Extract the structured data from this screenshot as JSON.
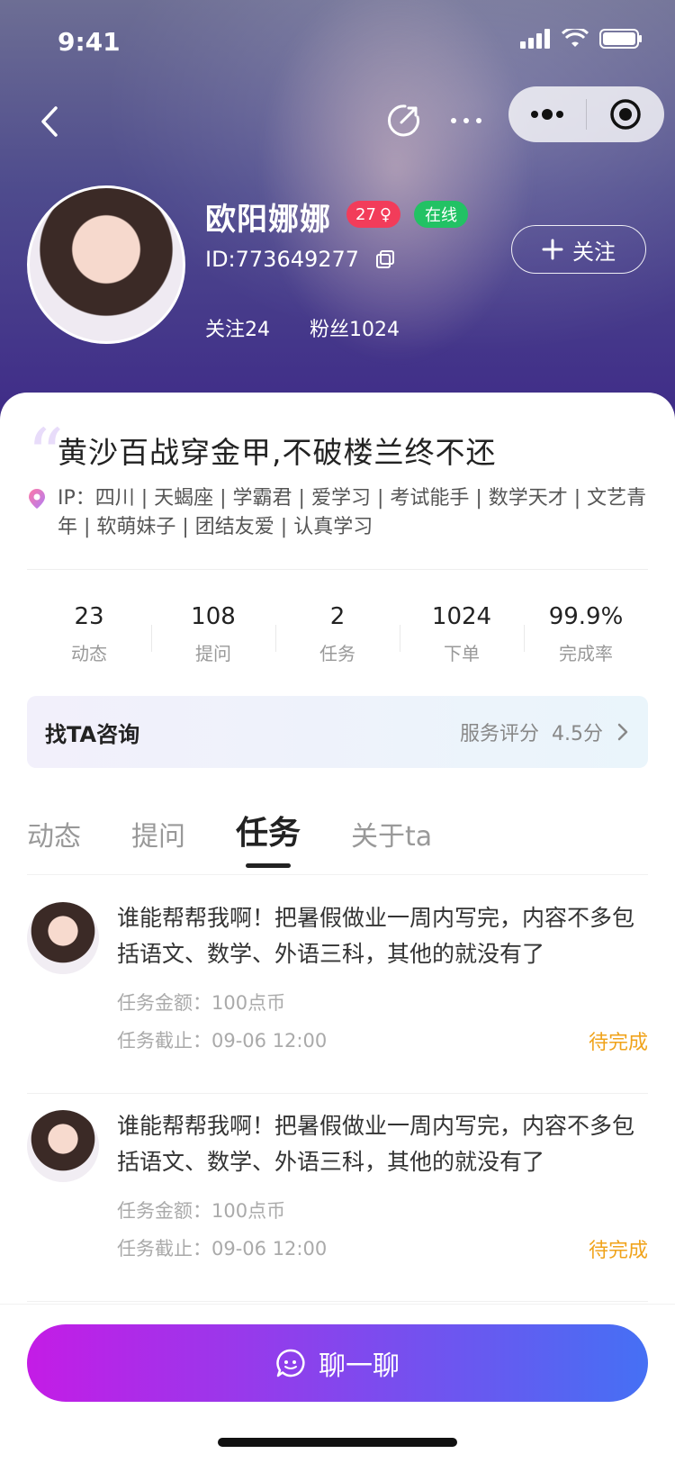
{
  "status_bar": {
    "time": "9:41"
  },
  "profile": {
    "name": "欧阳娜娜",
    "age": "27",
    "gender_symbol": "♀",
    "online": "在线",
    "id": "ID:773649277",
    "follow_label": "关注",
    "following": "关注24",
    "fans": "粉丝1024"
  },
  "motto": "黄沙百战穿金甲,不破楼兰终不还",
  "ip_line": "IP：四川 | 天蝎座 | 学霸君 | 爱学习 | 考试能手 | 数学天才 | 文艺青年 | 软萌妹子 | 团结友爱 | 认真学习",
  "stats": [
    {
      "num": "23",
      "label": "动态"
    },
    {
      "num": "108",
      "label": "提问"
    },
    {
      "num": "2",
      "label": "任务"
    },
    {
      "num": "1024",
      "label": "下单"
    },
    {
      "num": "99.9%",
      "label": "完成率"
    }
  ],
  "consult": {
    "title": "找TA咨询",
    "rating_label": "服务评分",
    "rating_value": "4.5分"
  },
  "tabs": [
    {
      "label": "动态"
    },
    {
      "label": "提问"
    },
    {
      "label": "任务"
    },
    {
      "label": "关于ta"
    }
  ],
  "tasks": [
    {
      "content": "谁能帮帮我啊！把暑假做业一周内写完，内容不多包括语文、数学、外语三科，其他的就没有了",
      "amount": "任务金额：100点币",
      "deadline": "任务截止：09-06 12:00",
      "status": "待完成"
    },
    {
      "content": "谁能帮帮我啊！把暑假做业一周内写完，内容不多包括语文、数学、外语三科，其他的就没有了",
      "amount": "任务金额：100点币",
      "deadline": "任务截止：09-06 12:00",
      "status": "待完成"
    }
  ],
  "chat_button": "聊一聊",
  "colors": {
    "accent_gradient_start": "#c41ce6",
    "accent_gradient_end": "#4570f4",
    "status_pending": "#f0a31b",
    "online_green": "#22c264",
    "age_red": "#f23c5a"
  }
}
